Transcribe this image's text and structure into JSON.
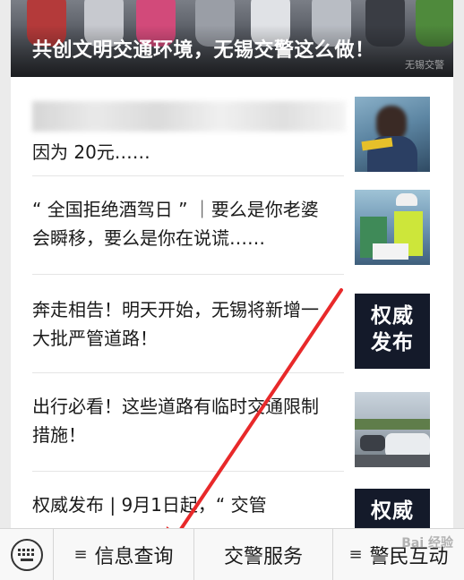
{
  "hero": {
    "title": "共创文明交通环境，无锡交警这么做！",
    "watermark": "无锡交警"
  },
  "articles": [
    {
      "title": "因为 20元……",
      "thumbnail_text": "",
      "blurred_first_line": true
    },
    {
      "title": "“ 全国拒绝酒驾日 ” ｜要么是你老婆会瞬移，要么是你在说谎……",
      "thumbnail_text": ""
    },
    {
      "title": "奔走相告！明天开始，无锡将新增一大批严管道路！",
      "thumbnail_text": "权威发布"
    },
    {
      "title": "出行必看！这些道路有临时交通限制措施！",
      "thumbnail_text": ""
    },
    {
      "title": "权威发布 | 9月1日起，“ 交管",
      "thumbnail_text": "权威"
    }
  ],
  "menu": {
    "keyboard_icon": "keyboard-icon",
    "items": [
      {
        "label": "信息查询",
        "icon": "menu-list-icon"
      },
      {
        "label": "交警服务",
        "icon": ""
      },
      {
        "label": "警民互动",
        "icon": "menu-list-icon"
      }
    ]
  },
  "watermark_text": "Bai 经验",
  "colors": {
    "arrow": "#e8292a",
    "authority_tile": "#141a2a",
    "menubar": "#f8f8f8"
  }
}
